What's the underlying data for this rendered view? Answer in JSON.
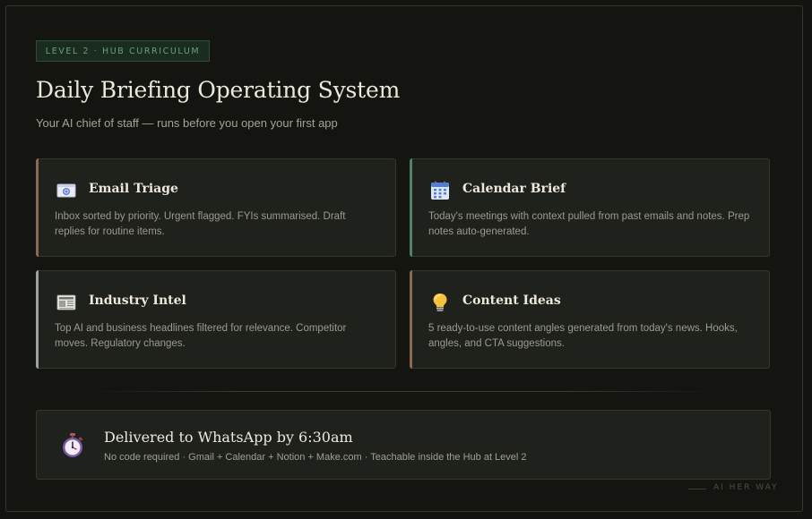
{
  "header": {
    "badge": "LEVEL 2 · HUB CURRICULUM",
    "title": "Daily Briefing Operating System",
    "subtitle": "Your AI chief of staff — runs before you open your first app"
  },
  "cards": [
    {
      "title": "Email Triage",
      "description": "Inbox sorted by priority. Urgent flagged. FYIs summarised. Draft replies for routine items.",
      "icon": "email-icon",
      "accent_color": "#8a6a52"
    },
    {
      "title": "Calendar Brief",
      "description": "Today's meetings with context pulled from past emails and notes. Prep notes auto-generated.",
      "icon": "calendar-icon",
      "accent_color": "#4f8466"
    },
    {
      "title": "Industry Intel",
      "description": "Top AI and business headlines filtered for relevance. Competitor moves. Regulatory changes.",
      "icon": "newspaper-icon",
      "accent_color": "#9aa2a0"
    },
    {
      "title": "Content Ideas",
      "description": "5 ready-to-use content angles generated from today's news. Hooks, angles, and CTA suggestions.",
      "icon": "lightbulb-icon",
      "accent_color": "#8a6a52"
    }
  ],
  "delivery": {
    "title": "Delivered to WhatsApp by 6:30am",
    "description": "No code required · Gmail + Calendar + Notion + Make.com · Teachable inside the Hub at Level 2",
    "icon": "stopwatch-icon"
  },
  "footer": {
    "brand": "AI HER WAY"
  },
  "colors": {
    "background": "#141511",
    "card": "#1f211d",
    "badge_text": "#6f9c7a",
    "badge_bg": "#1a2b1f"
  }
}
